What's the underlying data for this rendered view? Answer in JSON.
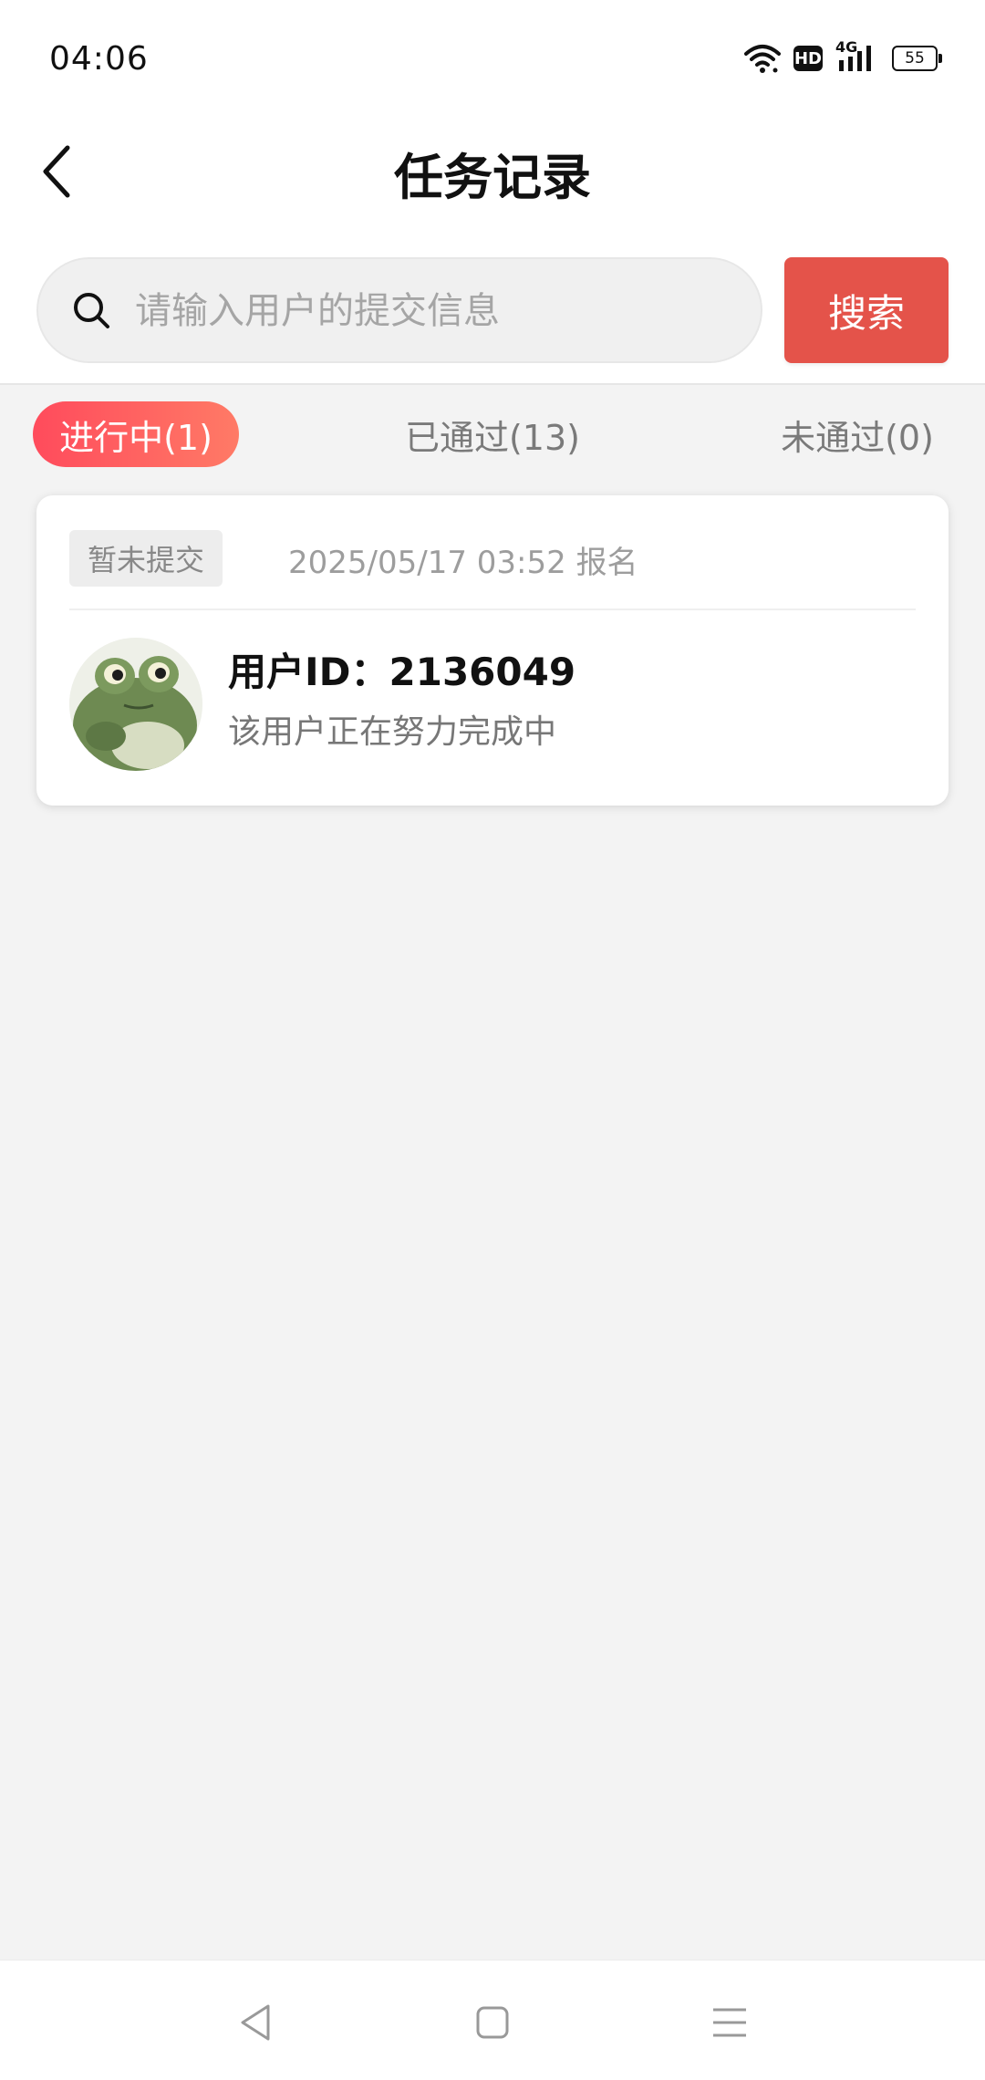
{
  "status_bar": {
    "time": "04:06",
    "network_label": "4G",
    "hd_label": "HD",
    "battery": "55",
    "icons": [
      "wifi-icon",
      "hd-icon",
      "signal-icon",
      "battery-icon"
    ]
  },
  "header": {
    "title": "任务记录",
    "back_icon": "chevron-left-icon"
  },
  "search": {
    "placeholder": "请输入用户的提交信息",
    "value": "",
    "button_label": "搜索",
    "icon": "search-icon"
  },
  "tabs": [
    {
      "label": "进行中(1)",
      "active": true
    },
    {
      "label": "已通过(13)",
      "active": false
    },
    {
      "label": "未通过(0)",
      "active": false
    }
  ],
  "records": [
    {
      "status": "暂未提交",
      "signup_time": "2025/05/17 03:52 报名",
      "user_id": "用户ID：2136049",
      "progress_text": "该用户正在努力完成中",
      "avatar": "frog-avatar"
    }
  ],
  "nav_bar": {
    "icons": [
      "nav-back-icon",
      "nav-home-icon",
      "nav-menu-icon"
    ]
  },
  "colors": {
    "accent": "#e4534a",
    "tab_gradient_start": "#ff4b5c",
    "tab_gradient_end": "#ff7a66",
    "background": "#f3f3f3"
  }
}
